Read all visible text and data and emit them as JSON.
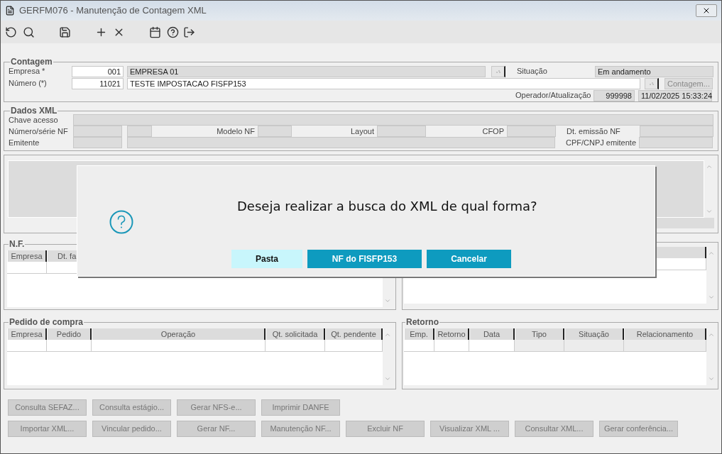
{
  "window": {
    "title": "GERFM076 - Manutenção de Contagem XML"
  },
  "contagem": {
    "title": "Contagem",
    "empresa_label": "Empresa *",
    "empresa_code": "001",
    "empresa_name": "EMPRESA 01",
    "numero_label": "Número (*)",
    "numero_code": "11021",
    "numero_desc": "TESTE IMPOSTACAO FISFP153",
    "situacao_label": "Situação",
    "situacao_value": "Em andamento",
    "contagem_button": {
      "label": "Contagem...",
      "disabled": true
    },
    "operador_label": "Operador/Atualização",
    "operador_value": "999998",
    "atualizacao_value": "11/02/2025 15:33:24"
  },
  "dados_xml": {
    "title": "Dados XML",
    "chave_label": "Chave acesso",
    "numero_serie_label": "Número/série NF",
    "modelo_label": "Modelo NF",
    "layout_label": "Layout",
    "cfop_label": "CFOP",
    "dt_emissao_label": "Dt. emissão NF",
    "emitente_label": "Emitente",
    "cpf_cnpj_label": "CPF/CNPJ emitente"
  },
  "nf": {
    "title": "N.F.",
    "columns": [
      "Empresa",
      "Dt. fa"
    ]
  },
  "pedido_compra": {
    "title": "Pedido de compra",
    "columns": [
      "Empresa",
      "Pedido",
      "Operação",
      "Qt. solicitada",
      "Qt. pendente"
    ]
  },
  "retorno": {
    "title": "Retorno",
    "columns": [
      "Emp.",
      "Retorno",
      "Data",
      "Tipo",
      "Situação",
      "Relacionamento"
    ]
  },
  "action_buttons": [
    [
      {
        "label": "Consulta SEFAZ...",
        "disabled": true
      },
      {
        "label": "Consulta estágio...",
        "disabled": true
      },
      {
        "label": "Gerar NFS-e...",
        "disabled": true
      },
      {
        "label": "Imprimir DANFE",
        "disabled": true
      }
    ],
    [
      {
        "label": "Importar XML...",
        "disabled": true
      },
      {
        "label": "Vincular pedido...",
        "disabled": true
      },
      {
        "label": "Gerar NF...",
        "disabled": true
      },
      {
        "label": "Manutenção NF...",
        "disabled": true
      },
      {
        "label": "Excluir NF",
        "disabled": true
      },
      {
        "label": "Visualizar XML ...",
        "disabled": true
      },
      {
        "label": "Consultar XML...",
        "disabled": true
      },
      {
        "label": "Gerar conferência...",
        "disabled": true
      }
    ]
  ],
  "dialog": {
    "message": "Deseja realizar a busca do XML de qual forma?",
    "buttons": [
      {
        "label": "Pasta",
        "focused": true
      },
      {
        "label": "NF do FISFP153",
        "focused": false
      },
      {
        "label": "Cancelar",
        "focused": false
      }
    ]
  }
}
